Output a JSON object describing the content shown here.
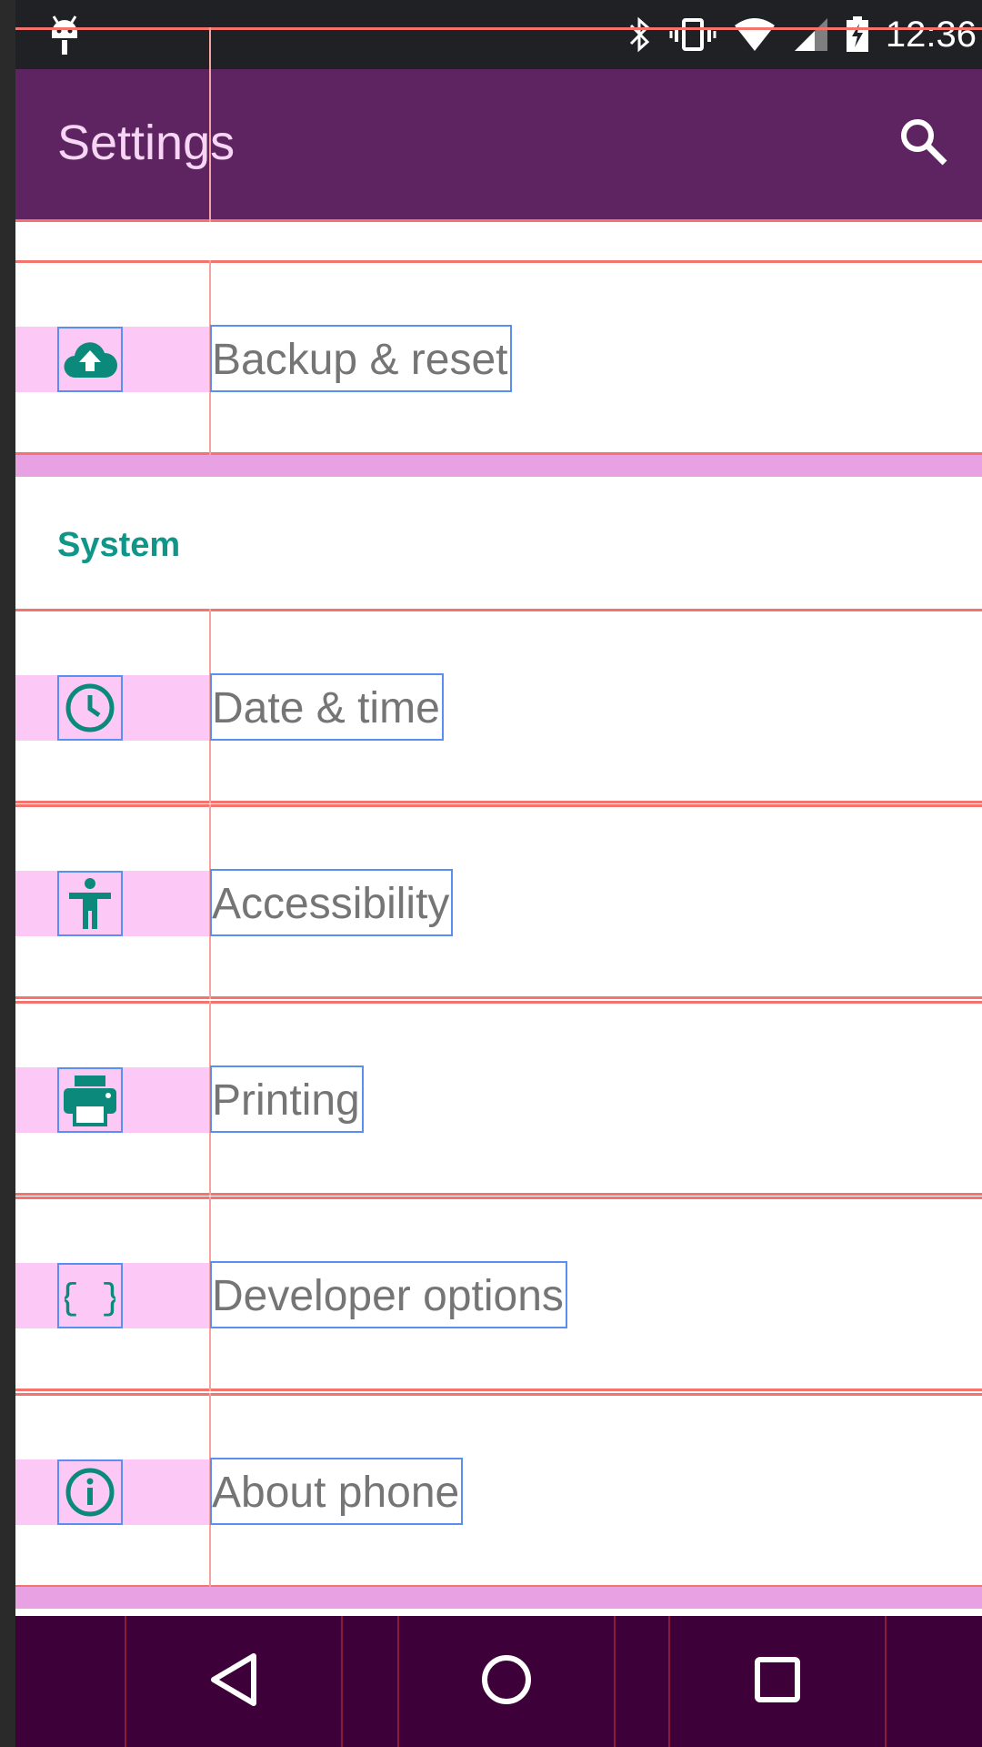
{
  "status_bar": {
    "time": "12:36"
  },
  "app_bar": {
    "title": "Settings"
  },
  "items_top": [
    {
      "label": "Backup & reset",
      "icon": "cloud-upload-icon"
    }
  ],
  "section": {
    "title": "System"
  },
  "items_system": [
    {
      "label": "Date & time",
      "icon": "clock-icon"
    },
    {
      "label": "Accessibility",
      "icon": "accessibility-icon"
    },
    {
      "label": "Printing",
      "icon": "printer-icon"
    },
    {
      "label": "Developer options",
      "icon": "code-braces-icon"
    },
    {
      "label": "About phone",
      "icon": "info-icon"
    }
  ],
  "colors": {
    "app_bar": "#5e2461",
    "accent": "#109688",
    "nav_bar": "#3d0039",
    "status_bar": "#202124"
  }
}
